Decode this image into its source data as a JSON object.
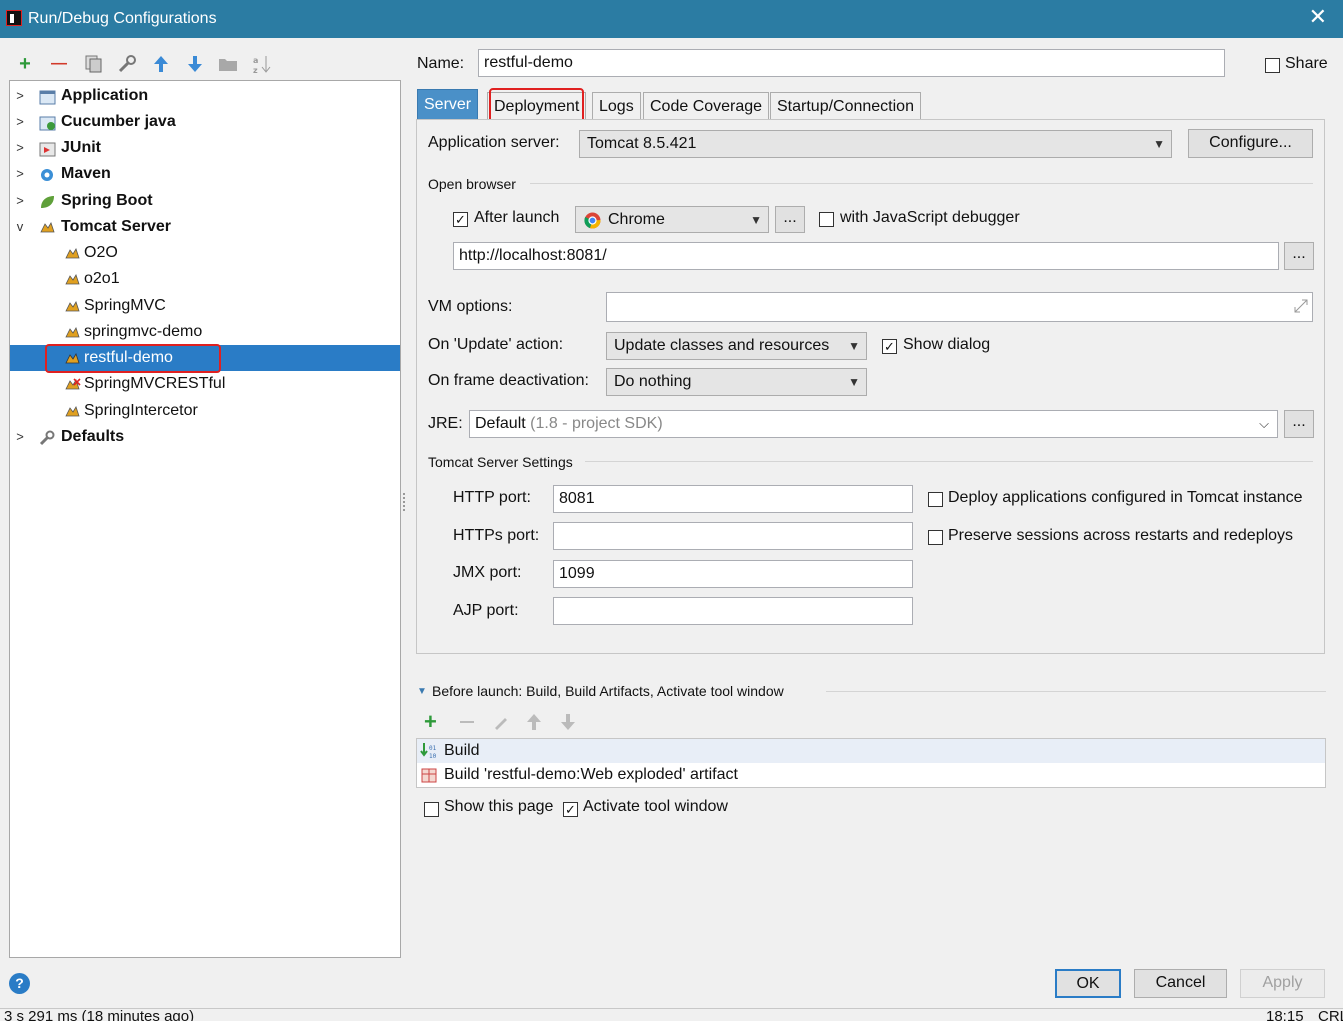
{
  "window": {
    "title": "Run/Debug Configurations",
    "close_glyph": "✕"
  },
  "toolbar": {
    "add": "+",
    "remove": "—"
  },
  "tree": {
    "items": [
      {
        "label": "Application",
        "bold": true,
        "arrow": ">"
      },
      {
        "label": "Cucumber java",
        "bold": true,
        "arrow": ">"
      },
      {
        "label": "JUnit",
        "bold": true,
        "arrow": ">"
      },
      {
        "label": "Maven",
        "bold": true,
        "arrow": ">"
      },
      {
        "label": "Spring Boot",
        "bold": true,
        "arrow": ">"
      },
      {
        "label": "Tomcat Server",
        "bold": true,
        "arrow": "v"
      },
      {
        "label": "O2O"
      },
      {
        "label": "o2o1"
      },
      {
        "label": "SpringMVC"
      },
      {
        "label": "springmvc-demo"
      },
      {
        "label": "restful-demo",
        "selected": true
      },
      {
        "label": "SpringMVCRESTful"
      },
      {
        "label": "SpringIntercetor"
      },
      {
        "label": "Defaults",
        "bold": true,
        "arrow": ">"
      }
    ]
  },
  "name": {
    "label": "Name:",
    "value": "restful-demo",
    "share_label": "Share"
  },
  "tabs": [
    "Server",
    "Deployment",
    "Logs",
    "Code Coverage",
    "Startup/Connection"
  ],
  "server": {
    "app_server_label": "Application server:",
    "app_server_value": "Tomcat 8.5.421",
    "configure_label": "Configure...",
    "open_browser_title": "Open browser",
    "after_launch_label": "After launch",
    "browser_value": "Chrome",
    "ellipsis": "...",
    "js_debugger_label": "with JavaScript debugger",
    "url_value": "http://localhost:8081/",
    "vm_options_label": "VM options:",
    "vm_options_value": "",
    "update_action_label": "On 'Update' action:",
    "update_action_value": "Update classes and resources",
    "show_dialog_label": "Show dialog",
    "frame_deactivation_label": "On frame deactivation:",
    "frame_deactivation_value": "Do nothing",
    "jre_label": "JRE:",
    "jre_value": "Default",
    "jre_hint": "(1.8 - project SDK)",
    "tomcat_settings_title": "Tomcat Server Settings",
    "http_port_label": "HTTP port:",
    "http_port_value": "8081",
    "https_port_label": "HTTPs port:",
    "https_port_value": "",
    "jmx_port_label": "JMX port:",
    "jmx_port_value": "1099",
    "ajp_port_label": "AJP port:",
    "ajp_port_value": "",
    "deploy_apps_label": "Deploy applications configured in Tomcat instance",
    "preserve_sessions_label": "Preserve sessions across restarts and redeploys"
  },
  "before_launch": {
    "title": "Before launch: Build, Build Artifacts, Activate tool window",
    "tasks": [
      "Build",
      "Build 'restful-demo:Web exploded' artifact"
    ],
    "show_page_label": "Show this page",
    "activate_tool_window_label": "Activate tool window"
  },
  "buttons": {
    "ok": "OK",
    "cancel": "Cancel",
    "apply": "Apply"
  },
  "status": {
    "left": "3 s 291 ms (18 minutes ago)",
    "right": "18:15",
    "right2": "CRL"
  },
  "colors": {
    "titlebar": "#2b7ca3",
    "selection": "#2a7cc6",
    "highlight": "#e02020"
  }
}
